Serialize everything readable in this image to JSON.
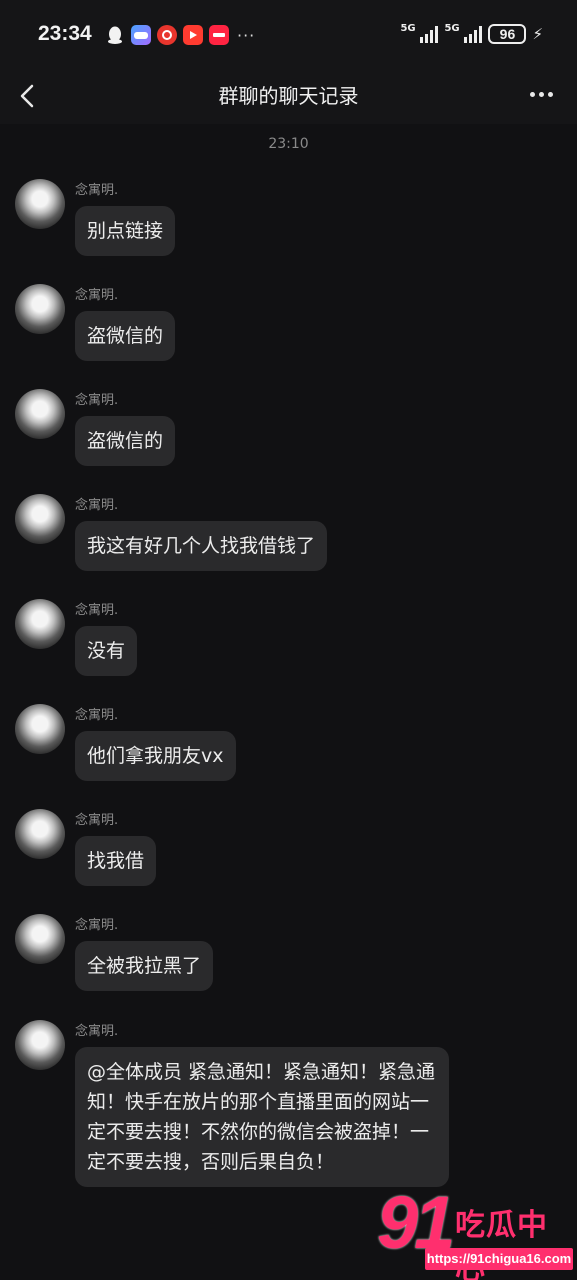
{
  "status_bar": {
    "time": "23:34",
    "more": "···",
    "signal_1": "5G",
    "signal_2": "5G",
    "battery": "96",
    "app_icons": [
      "qq-icon",
      "game-icon",
      "netease-music-icon",
      "video-icon",
      "xiaohongshu-icon"
    ]
  },
  "nav": {
    "title": "群聊的聊天记录"
  },
  "chat": {
    "timestamp": "23:10",
    "messages": [
      {
        "sender": "念寓明.",
        "text": "别点链接"
      },
      {
        "sender": "念寓明.",
        "text": "盗微信的"
      },
      {
        "sender": "念寓明.",
        "text": "盗微信的"
      },
      {
        "sender": "念寓明.",
        "text": "我这有好几个人找我借钱了"
      },
      {
        "sender": "念寓明.",
        "text": "没有"
      },
      {
        "sender": "念寓明.",
        "text": "他们拿我朋友vx"
      },
      {
        "sender": "念寓明.",
        "text": "找我借"
      },
      {
        "sender": "念寓明.",
        "text": "全被我拉黑了"
      },
      {
        "sender": "念寓明.",
        "text": "@全体成员  紧急通知！紧急通知！紧急通知！快手在放片的那个直播里面的网站一定不要去搜！不然你的微信会被盗掉！一定不要去搜，否则后果自负！"
      }
    ]
  },
  "watermark": {
    "number": "91",
    "brand": "吃瓜中心",
    "url": "https://91chigua16.com"
  }
}
